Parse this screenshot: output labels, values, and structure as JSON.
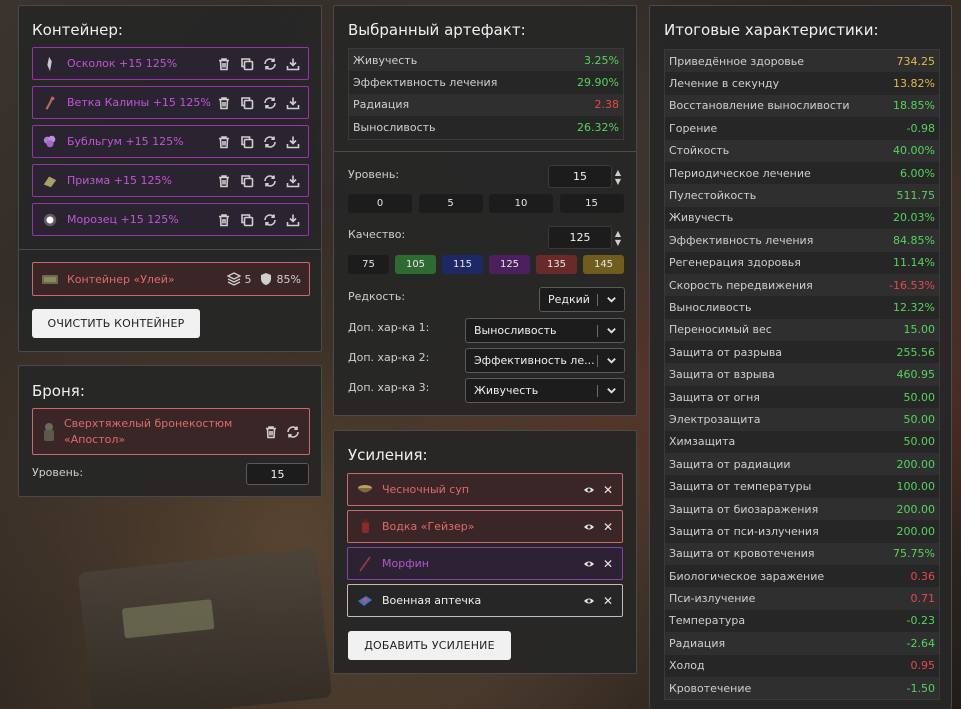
{
  "container": {
    "title": "Контейнер:",
    "slots": [
      {
        "label": "Осколок +15 125%",
        "icon": "shard-icon"
      },
      {
        "label": "Ветка Калины +15 125%",
        "icon": "branch-icon"
      },
      {
        "label": "Бубльгум +15 125%",
        "icon": "bubblegum-icon"
      },
      {
        "label": "Призма +15 125%",
        "icon": "prism-icon"
      },
      {
        "label": "Морозец +15 125%",
        "icon": "frost-icon"
      }
    ],
    "item": {
      "label": "Контейнер «Улей»",
      "slots_count": "5",
      "protection": "85%"
    },
    "clear_label": "ОЧИСТИТЬ КОНТЕЙНЕР",
    "accent": "#9b2fb0"
  },
  "armor": {
    "title": "Броня:",
    "item_line1": "Сверхтяжелый бронекостюм",
    "item_line2": "«Апостол»",
    "level_label": "Уровень:",
    "level_value": "15"
  },
  "artifact": {
    "title": "Выбранный артефакт:",
    "stats": [
      {
        "name": "Живучесть",
        "value": "3.25%",
        "color": "green"
      },
      {
        "name": "Эффективность лечения",
        "value": "29.90%",
        "color": "green"
      },
      {
        "name": "Радиация",
        "value": "2.38",
        "color": "red"
      },
      {
        "name": "Выносливость",
        "value": "26.32%",
        "color": "green"
      }
    ],
    "level_label": "Уровень:",
    "level_value": "15",
    "level_quick": [
      "0",
      "5",
      "10",
      "15"
    ],
    "quality_label": "Качество:",
    "quality_value": "125",
    "quality_quick": [
      {
        "label": "75",
        "color": "#1c1c1c"
      },
      {
        "label": "105",
        "color": "#2e6b33"
      },
      {
        "label": "115",
        "color": "#1f2866"
      },
      {
        "label": "125",
        "color": "#4c1f5e"
      },
      {
        "label": "135",
        "color": "#6a2a2a"
      },
      {
        "label": "145",
        "color": "#6e5d1c"
      }
    ],
    "rarity_label": "Редкость:",
    "rarity_value": "Редкий",
    "extra1_label": "Доп. хар-ка 1:",
    "extra1_value": "Выносливость",
    "extra2_label": "Доп. хар-ка 2:",
    "extra2_value": "Эффективность ле...",
    "extra3_label": "Доп. хар-ка 3:",
    "extra3_value": "Живучесть"
  },
  "boosts": {
    "title": "Усиления:",
    "items": [
      {
        "label": "Чесночный суп",
        "border": "#c96a6a",
        "bg": "#3a2626",
        "color": "#e06a6a"
      },
      {
        "label": "Водка «Гейзер»",
        "border": "#c96a6a",
        "bg": "#3a2626",
        "color": "#e06a6a"
      },
      {
        "label": "Морфин",
        "border": "#8e3fa6",
        "bg": "#2d2233",
        "color": "#b456cf"
      },
      {
        "label": "Военная аптечка",
        "border": "#bdbdbd",
        "bg": "#262626",
        "color": "#f0f0f0"
      }
    ],
    "add_label": "ДОБАВИТЬ УСИЛЕНИЕ"
  },
  "totals": {
    "title": "Итоговые характеристики:",
    "stats": [
      {
        "name": "Приведённое здоровье",
        "value": "734.25",
        "color": "yellow"
      },
      {
        "name": "Лечение в секунду",
        "value": "13.82%",
        "color": "yellow"
      },
      {
        "name": "Восстановление выносливости",
        "value": "18.85%",
        "color": "green"
      },
      {
        "name": "Горение",
        "value": "-0.98",
        "color": "green"
      },
      {
        "name": "Стойкость",
        "value": "40.00%",
        "color": "green"
      },
      {
        "name": "Периодическое лечение",
        "value": "6.00%",
        "color": "green"
      },
      {
        "name": "Пулестойкость",
        "value": "511.75",
        "color": "green"
      },
      {
        "name": "Живучесть",
        "value": "20.03%",
        "color": "green"
      },
      {
        "name": "Эффективность лечения",
        "value": "84.85%",
        "color": "green"
      },
      {
        "name": "Регенерация здоровья",
        "value": "11.14%",
        "color": "green"
      },
      {
        "name": "Скорость передвижения",
        "value": "-16.53%",
        "color": "red"
      },
      {
        "name": "Выносливость",
        "value": "12.32%",
        "color": "green"
      },
      {
        "name": "Переносимый вес",
        "value": "15.00",
        "color": "green"
      },
      {
        "name": "Защита от разрыва",
        "value": "255.56",
        "color": "green"
      },
      {
        "name": "Защита от взрыва",
        "value": "460.95",
        "color": "green"
      },
      {
        "name": "Защита от огня",
        "value": "50.00",
        "color": "green"
      },
      {
        "name": "Электрозащита",
        "value": "50.00",
        "color": "green"
      },
      {
        "name": "Химзащита",
        "value": "50.00",
        "color": "green"
      },
      {
        "name": "Защита от радиации",
        "value": "200.00",
        "color": "green"
      },
      {
        "name": "Защита от температуры",
        "value": "100.00",
        "color": "green"
      },
      {
        "name": "Защита от биозаражения",
        "value": "200.00",
        "color": "green"
      },
      {
        "name": "Защита от пси-излучения",
        "value": "200.00",
        "color": "green"
      },
      {
        "name": "Защита от кровотечения",
        "value": "75.75%",
        "color": "green"
      },
      {
        "name": "Биологическое заражение",
        "value": "0.36",
        "color": "red"
      },
      {
        "name": "Пси-излучение",
        "value": "0.71",
        "color": "red"
      },
      {
        "name": "Температура",
        "value": "-0.23",
        "color": "green"
      },
      {
        "name": "Радиация",
        "value": "-2.64",
        "color": "green"
      },
      {
        "name": "Холод",
        "value": "0.95",
        "color": "red"
      },
      {
        "name": "Кровотечение",
        "value": "-1.50",
        "color": "green"
      }
    ]
  }
}
